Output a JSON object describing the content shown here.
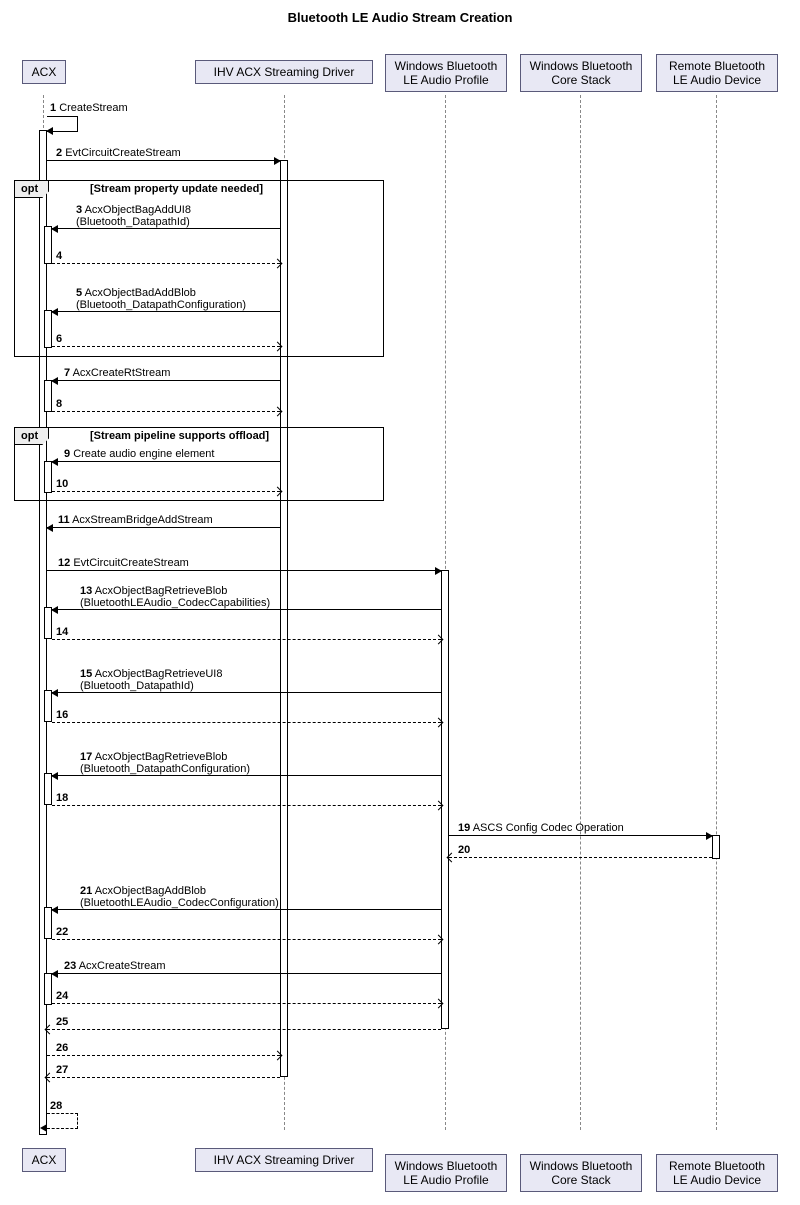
{
  "title": "Bluetooth LE Audio Stream Creation",
  "participants": {
    "p0": "ACX",
    "p1": "IHV ACX Streaming Driver",
    "p2": "Windows Bluetooth\nLE Audio Profile",
    "p3": "Windows Bluetooth\nCore Stack",
    "p4": "Remote Bluetooth\nLE Audio Device"
  },
  "opt": {
    "opt1": {
      "label": "opt",
      "guard": "[Stream property update needed]"
    },
    "opt2": {
      "label": "opt",
      "guard": "[Stream pipeline supports offload]"
    }
  },
  "messages": {
    "m1": {
      "n": "1",
      "t": "CreateStream"
    },
    "m2": {
      "n": "2",
      "t": "EvtCircuitCreateStream"
    },
    "m3": {
      "n": "3",
      "t": "AcxObjectBagAddUI8\n(Bluetooth_DatapathId)"
    },
    "m4": {
      "n": "4",
      "t": ""
    },
    "m5": {
      "n": "5",
      "t": "AcxObjectBadAddBlob\n(Bluetooth_DatapathConfiguration)"
    },
    "m6": {
      "n": "6",
      "t": ""
    },
    "m7": {
      "n": "7",
      "t": "AcxCreateRtStream"
    },
    "m8": {
      "n": "8",
      "t": ""
    },
    "m9": {
      "n": "9",
      "t": "Create audio engine element"
    },
    "m10": {
      "n": "10",
      "t": ""
    },
    "m11": {
      "n": "11",
      "t": "AcxStreamBridgeAddStream"
    },
    "m12": {
      "n": "12",
      "t": "EvtCircuitCreateStream"
    },
    "m13": {
      "n": "13",
      "t": "AcxObjectBagRetrieveBlob\n(BluetoothLEAudio_CodecCapabilities)"
    },
    "m14": {
      "n": "14",
      "t": ""
    },
    "m15": {
      "n": "15",
      "t": "AcxObjectBagRetrieveUI8\n(Bluetooth_DatapathId)"
    },
    "m16": {
      "n": "16",
      "t": ""
    },
    "m17": {
      "n": "17",
      "t": "AcxObjectBagRetrieveBlob\n(Bluetooth_DatapathConfiguration)"
    },
    "m18": {
      "n": "18",
      "t": ""
    },
    "m19": {
      "n": "19",
      "t": "ASCS Config Codec Operation"
    },
    "m20": {
      "n": "20",
      "t": ""
    },
    "m21": {
      "n": "21",
      "t": "AcxObjectBagAddBlob\n(BluetoothLEAudio_CodecConfiguration)"
    },
    "m22": {
      "n": "22",
      "t": ""
    },
    "m23": {
      "n": "23",
      "t": "AcxCreateStream"
    },
    "m24": {
      "n": "24",
      "t": ""
    },
    "m25": {
      "n": "25",
      "t": ""
    },
    "m26": {
      "n": "26",
      "t": ""
    },
    "m27": {
      "n": "27",
      "t": ""
    },
    "m28": {
      "n": "28",
      "t": ""
    }
  }
}
